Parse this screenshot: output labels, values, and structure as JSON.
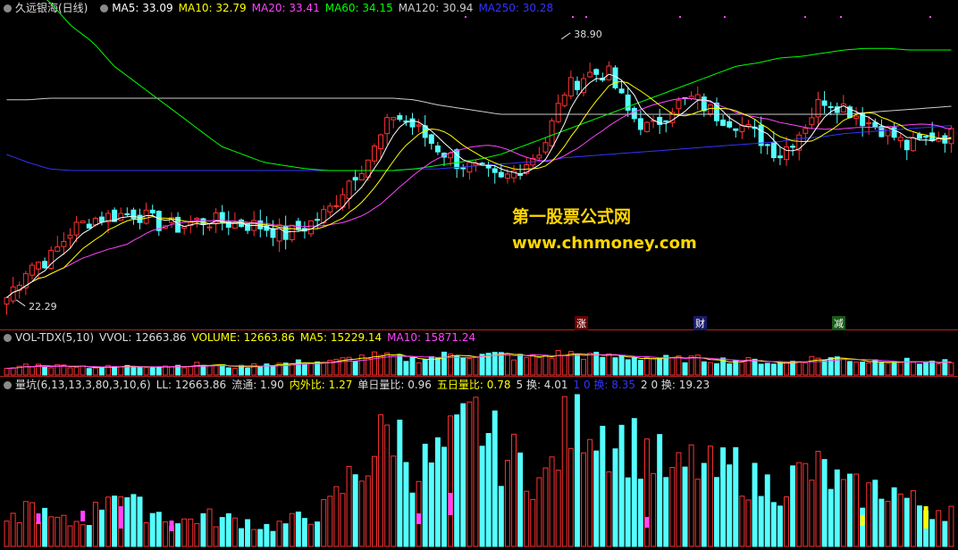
{
  "main_legend": {
    "title": "久远银海(日线)",
    "items": [
      {
        "text": "MA5: 33.09",
        "color": "#ffffff"
      },
      {
        "text": "MA10: 32.79",
        "color": "#ffff00"
      },
      {
        "text": "MA20: 33.41",
        "color": "#ff44ff"
      },
      {
        "text": "MA60: 34.15",
        "color": "#00ff00"
      },
      {
        "text": "MA120: 30.94",
        "color": "#cccccc"
      },
      {
        "text": "MA250: 30.28",
        "color": "#3333ff"
      }
    ]
  },
  "vol_legend": {
    "title": "VOL-TDX(5,10)",
    "items": [
      {
        "text": "VVOL: 12663.86",
        "color": "#dddddd"
      },
      {
        "text": "VOLUME: 12663.86",
        "color": "#ffff00"
      },
      {
        "text": "MA5: 15229.14",
        "color": "#ffff00"
      },
      {
        "text": "MA10: 15871.24",
        "color": "#ff44ff"
      }
    ]
  },
  "ind_legend": {
    "title": "量坑(6,13,13,3,80,3,10,6)",
    "items": [
      {
        "text": "LL: 12663.86",
        "color": "#dddddd"
      },
      {
        "text": "流通: 1.90",
        "color": "#dddddd"
      },
      {
        "text": "内外比: 1.27",
        "color": "#ffff00"
      },
      {
        "text": "单日量比: 0.96",
        "color": "#dddddd"
      },
      {
        "text": "五日量比: 0.78",
        "color": "#ffff00"
      },
      {
        "text": "5 换: 4.01",
        "color": "#dddddd"
      },
      {
        "text": "1 0 换: 8.35",
        "color": "#3333ff"
      },
      {
        "text": "2 0 换: 19.23",
        "color": "#dddddd"
      }
    ]
  },
  "watermark": {
    "line1": "第一股票公式网",
    "line2": "www.chnmoney.com"
  },
  "price_labels": {
    "high": "38.90",
    "low": "22.29"
  },
  "event_tags": [
    "涨",
    "财",
    "减"
  ],
  "chart_data": {
    "type": "candlestick",
    "title": "久远银海(日线)",
    "price_range": [
      21,
      40
    ],
    "high_marker": 38.9,
    "low_marker": 22.29,
    "note": "approximate reading",
    "colors": {
      "up": "#ff3232",
      "down": "#54ffff",
      "ma5": "#ffffff",
      "ma10": "#ffff00",
      "ma20": "#ff44ff",
      "ma60": "#00ff00",
      "ma120": "#cccccc",
      "ma250": "#3333ff"
    },
    "closes_ctrl": [
      22.6,
      24.6,
      25.0,
      26.8,
      27.5,
      27.7,
      27.9,
      27.2,
      27.0,
      27.4,
      27.3,
      27.2,
      27.0,
      26.5,
      27.1,
      28.0,
      30.0,
      31.5,
      34.0,
      33.2,
      32.0,
      31.0,
      30.5,
      29.8,
      30.8,
      32.0,
      35.5,
      36.5,
      36.6,
      34.0,
      33.0,
      34.5,
      35.0,
      34.0,
      33.5,
      32.6,
      31.5,
      33.0,
      35.0,
      34.5,
      33.6,
      33.0,
      31.9,
      32.6,
      32.7
    ],
    "ma250_ctrl": [
      31.5,
      31.0,
      30.6,
      30.5,
      30.5,
      30.5,
      30.5,
      30.5,
      30.5,
      30.5,
      30.5,
      30.5,
      30.5,
      30.5,
      30.5,
      30.5,
      30.5,
      30.5,
      30.5,
      30.6,
      30.6,
      30.7,
      30.8,
      30.9,
      31.0,
      31.1,
      31.3,
      31.4,
      31.5,
      31.6,
      31.7,
      31.8,
      31.9,
      32.0,
      32.1,
      32.2,
      32.3,
      32.5,
      32.6,
      32.8,
      32.9,
      33.0,
      33.1,
      33.2,
      33.3
    ],
    "ma120_ctrl": [
      34.9,
      34.9,
      35.0,
      35.0,
      35.0,
      35.0,
      35.0,
      35.0,
      35.0,
      35.0,
      35.0,
      35.0,
      35.0,
      35.0,
      35.0,
      35.0,
      35.0,
      35.0,
      35.0,
      34.9,
      34.6,
      34.4,
      34.2,
      34.0,
      34.0,
      34.0,
      34.0,
      34.0,
      34.0,
      34.0,
      34.0,
      34.0,
      34.0,
      34.0,
      34.0,
      34.0,
      34.0,
      34.0,
      34.0,
      34.0,
      34.1,
      34.2,
      34.3,
      34.4,
      34.5
    ],
    "ma60_ctrl": [
      43.0,
      42.0,
      41.0,
      39.5,
      38.5,
      37.0,
      36.0,
      35.0,
      34.0,
      33.0,
      32.0,
      31.5,
      31.0,
      30.8,
      30.6,
      30.5,
      30.5,
      30.5,
      30.5,
      30.6,
      30.8,
      31.0,
      31.2,
      31.5,
      32.0,
      32.5,
      33.0,
      33.5,
      34.0,
      34.5,
      35.0,
      35.5,
      36.0,
      36.5,
      37.0,
      37.2,
      37.5,
      37.6,
      37.8,
      38.0,
      38.1,
      38.1,
      38.0,
      38.0,
      38.0
    ],
    "volume_ctrl": [
      30,
      55,
      45,
      50,
      40,
      42,
      45,
      50,
      48,
      55,
      45,
      40,
      60,
      58,
      70,
      65,
      85,
      100,
      90,
      80,
      95,
      110,
      100,
      105,
      90,
      95,
      115,
      100,
      95,
      90,
      92,
      80,
      85,
      78,
      76,
      72,
      60,
      80,
      90,
      85,
      70,
      80,
      70,
      65,
      64
    ],
    "pit_ctrl": [
      25,
      55,
      35,
      30,
      40,
      85,
      50,
      45,
      30,
      40,
      35,
      35,
      25,
      30,
      40,
      50,
      90,
      120,
      160,
      100,
      115,
      140,
      170,
      120,
      110,
      80,
      150,
      180,
      150,
      135,
      125,
      90,
      110,
      95,
      105,
      80,
      80,
      95,
      100,
      75,
      70,
      80,
      60,
      50,
      50
    ]
  }
}
